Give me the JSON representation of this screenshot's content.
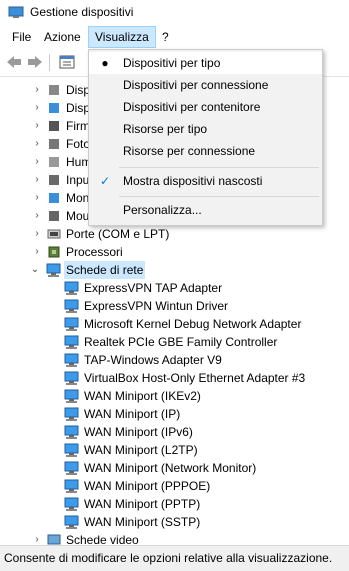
{
  "window": {
    "title": "Gestione dispositivi"
  },
  "menubar": {
    "items": [
      "File",
      "Azione",
      "Visualizza",
      "?"
    ]
  },
  "tree": {
    "partial_rows": [
      {
        "label": "Disp",
        "icon": "disk-icon"
      },
      {
        "label": "Disp",
        "icon": "display-icon"
      },
      {
        "label": "Firm",
        "icon": "firmware-icon"
      },
      {
        "label": "Foto",
        "icon": "camera-icon"
      },
      {
        "label": "Hum",
        "icon": "hid-icon"
      },
      {
        "label": "Inpu",
        "icon": "input-icon"
      },
      {
        "label": "Mon",
        "icon": "monitor-icon"
      },
      {
        "label": "Mou",
        "icon": "mouse-icon"
      }
    ],
    "rows": [
      {
        "label": "Porte (COM e LPT)",
        "icon": "port-icon"
      },
      {
        "label": "Processori",
        "icon": "processor-icon"
      },
      {
        "label": "Schede di rete",
        "icon": "network-icon"
      }
    ],
    "network_adapters": [
      "ExpressVPN TAP Adapter",
      "ExpressVPN Wintun Driver",
      "Microsoft Kernel Debug Network Adapter",
      "Realtek PCIe GBE Family Controller",
      "TAP-Windows Adapter V9",
      "VirtualBox Host-Only Ethernet Adapter #3",
      "WAN Miniport (IKEv2)",
      "WAN Miniport (IP)",
      "WAN Miniport (IPv6)",
      "WAN Miniport (L2TP)",
      "WAN Miniport (Network Monitor)",
      "WAN Miniport (PPPOE)",
      "WAN Miniport (PPTP)",
      "WAN Miniport (SSTP)"
    ],
    "after_rows": [
      {
        "label": "Schede video",
        "icon": "video-icon"
      }
    ]
  },
  "visualizza_menu": {
    "items": [
      {
        "label": "Dispositivi per tipo",
        "mark": "●"
      },
      {
        "label": "Dispositivi per connessione",
        "mark": ""
      },
      {
        "label": "Dispositivi per contenitore",
        "mark": ""
      },
      {
        "label": "Risorse per tipo",
        "mark": ""
      },
      {
        "label": "Risorse per connessione",
        "mark": ""
      },
      {
        "label": "Mostra dispositivi nascosti",
        "mark": "✓"
      },
      {
        "label": "Personalizza...",
        "mark": ""
      }
    ]
  },
  "statusbar": {
    "text": "Consente di modificare le opzioni relative alla visualizzazione."
  },
  "colors": {
    "highlight": "#cce8ff",
    "menu_bg": "#f2f2f2",
    "accent": "#0078d7"
  }
}
